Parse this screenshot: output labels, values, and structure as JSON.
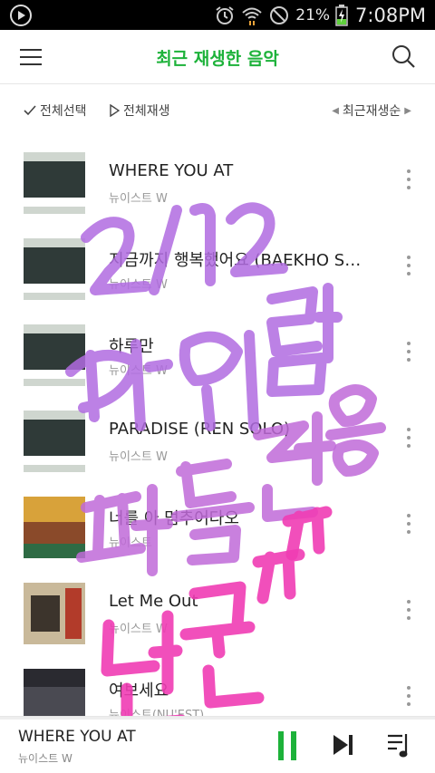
{
  "status_bar": {
    "battery_percent": "21%",
    "time": "7:08PM",
    "icons": [
      "play-circle-icon",
      "alarm-icon",
      "wifi-icon",
      "no-sim-icon",
      "battery-charging-icon"
    ]
  },
  "header": {
    "title": "최근 재생한 음악",
    "menu_icon": "hamburger-icon",
    "search_icon": "search-icon",
    "accent_color": "#1db23a"
  },
  "toolbar": {
    "select_all": "전체선택",
    "play_all": "전체재생",
    "sort": "최근재생순"
  },
  "songs": [
    {
      "title": "WHERE YOU AT",
      "artist": "뉴이스트 W"
    },
    {
      "title": "지금까지 행복했어요 (BAEKHO S…",
      "artist": "뉴이스트 W"
    },
    {
      "title": "하루만",
      "artist": "뉴이스트 W"
    },
    {
      "title": "PARADISE (REN SOLO)",
      "artist": "뉴이스트 W"
    },
    {
      "title": "너를 아 멈추어다오",
      "artist": "뉴이스트"
    },
    {
      "title": "Let Me Out",
      "artist": "뉴이스트 W"
    },
    {
      "title": "여보세요",
      "artist": "뉴이스트(NU'EST)"
    }
  ],
  "now_playing": {
    "title": "WHERE YOU AT",
    "artist": "뉴이스트 W",
    "progress": 0.0
  },
  "overlay_handwriting": [
    "2/12",
    "해외랩",
    "패통전용",
    "단콘ㅠㅠ"
  ]
}
